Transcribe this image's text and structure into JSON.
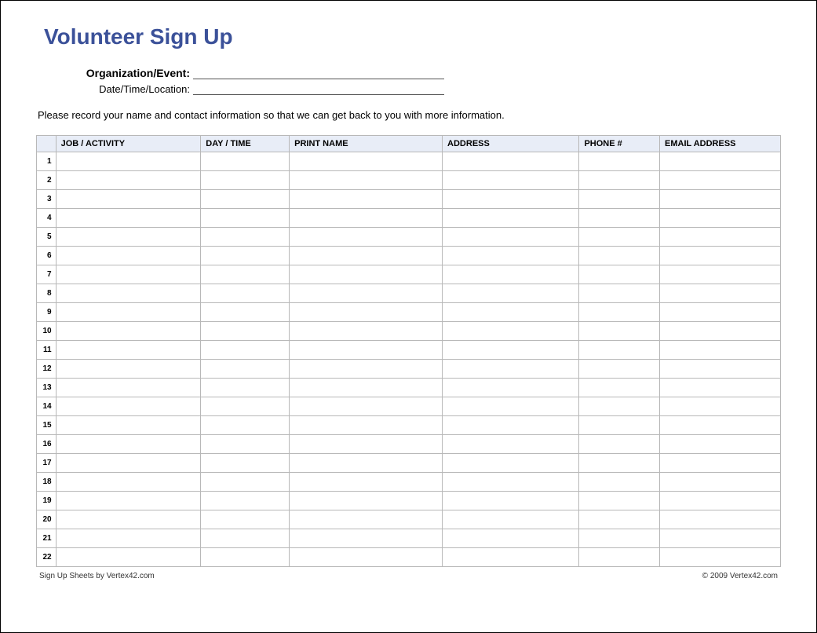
{
  "title": "Volunteer Sign Up",
  "fields": {
    "org_label": "Organization/Event:",
    "datetime_label": "Date/Time/Location:"
  },
  "instructions": "Please record your name and contact information so that we can get back to you with more information.",
  "table": {
    "headers": {
      "job": "JOB / ACTIVITY",
      "daytime": "DAY / TIME",
      "name": "PRINT NAME",
      "address": "ADDRESS",
      "phone": "PHONE #",
      "email": "EMAIL ADDRESS"
    },
    "row_count": 22
  },
  "footer": {
    "left": "Sign Up Sheets by Vertex42.com",
    "right": "© 2009 Vertex42.com"
  }
}
